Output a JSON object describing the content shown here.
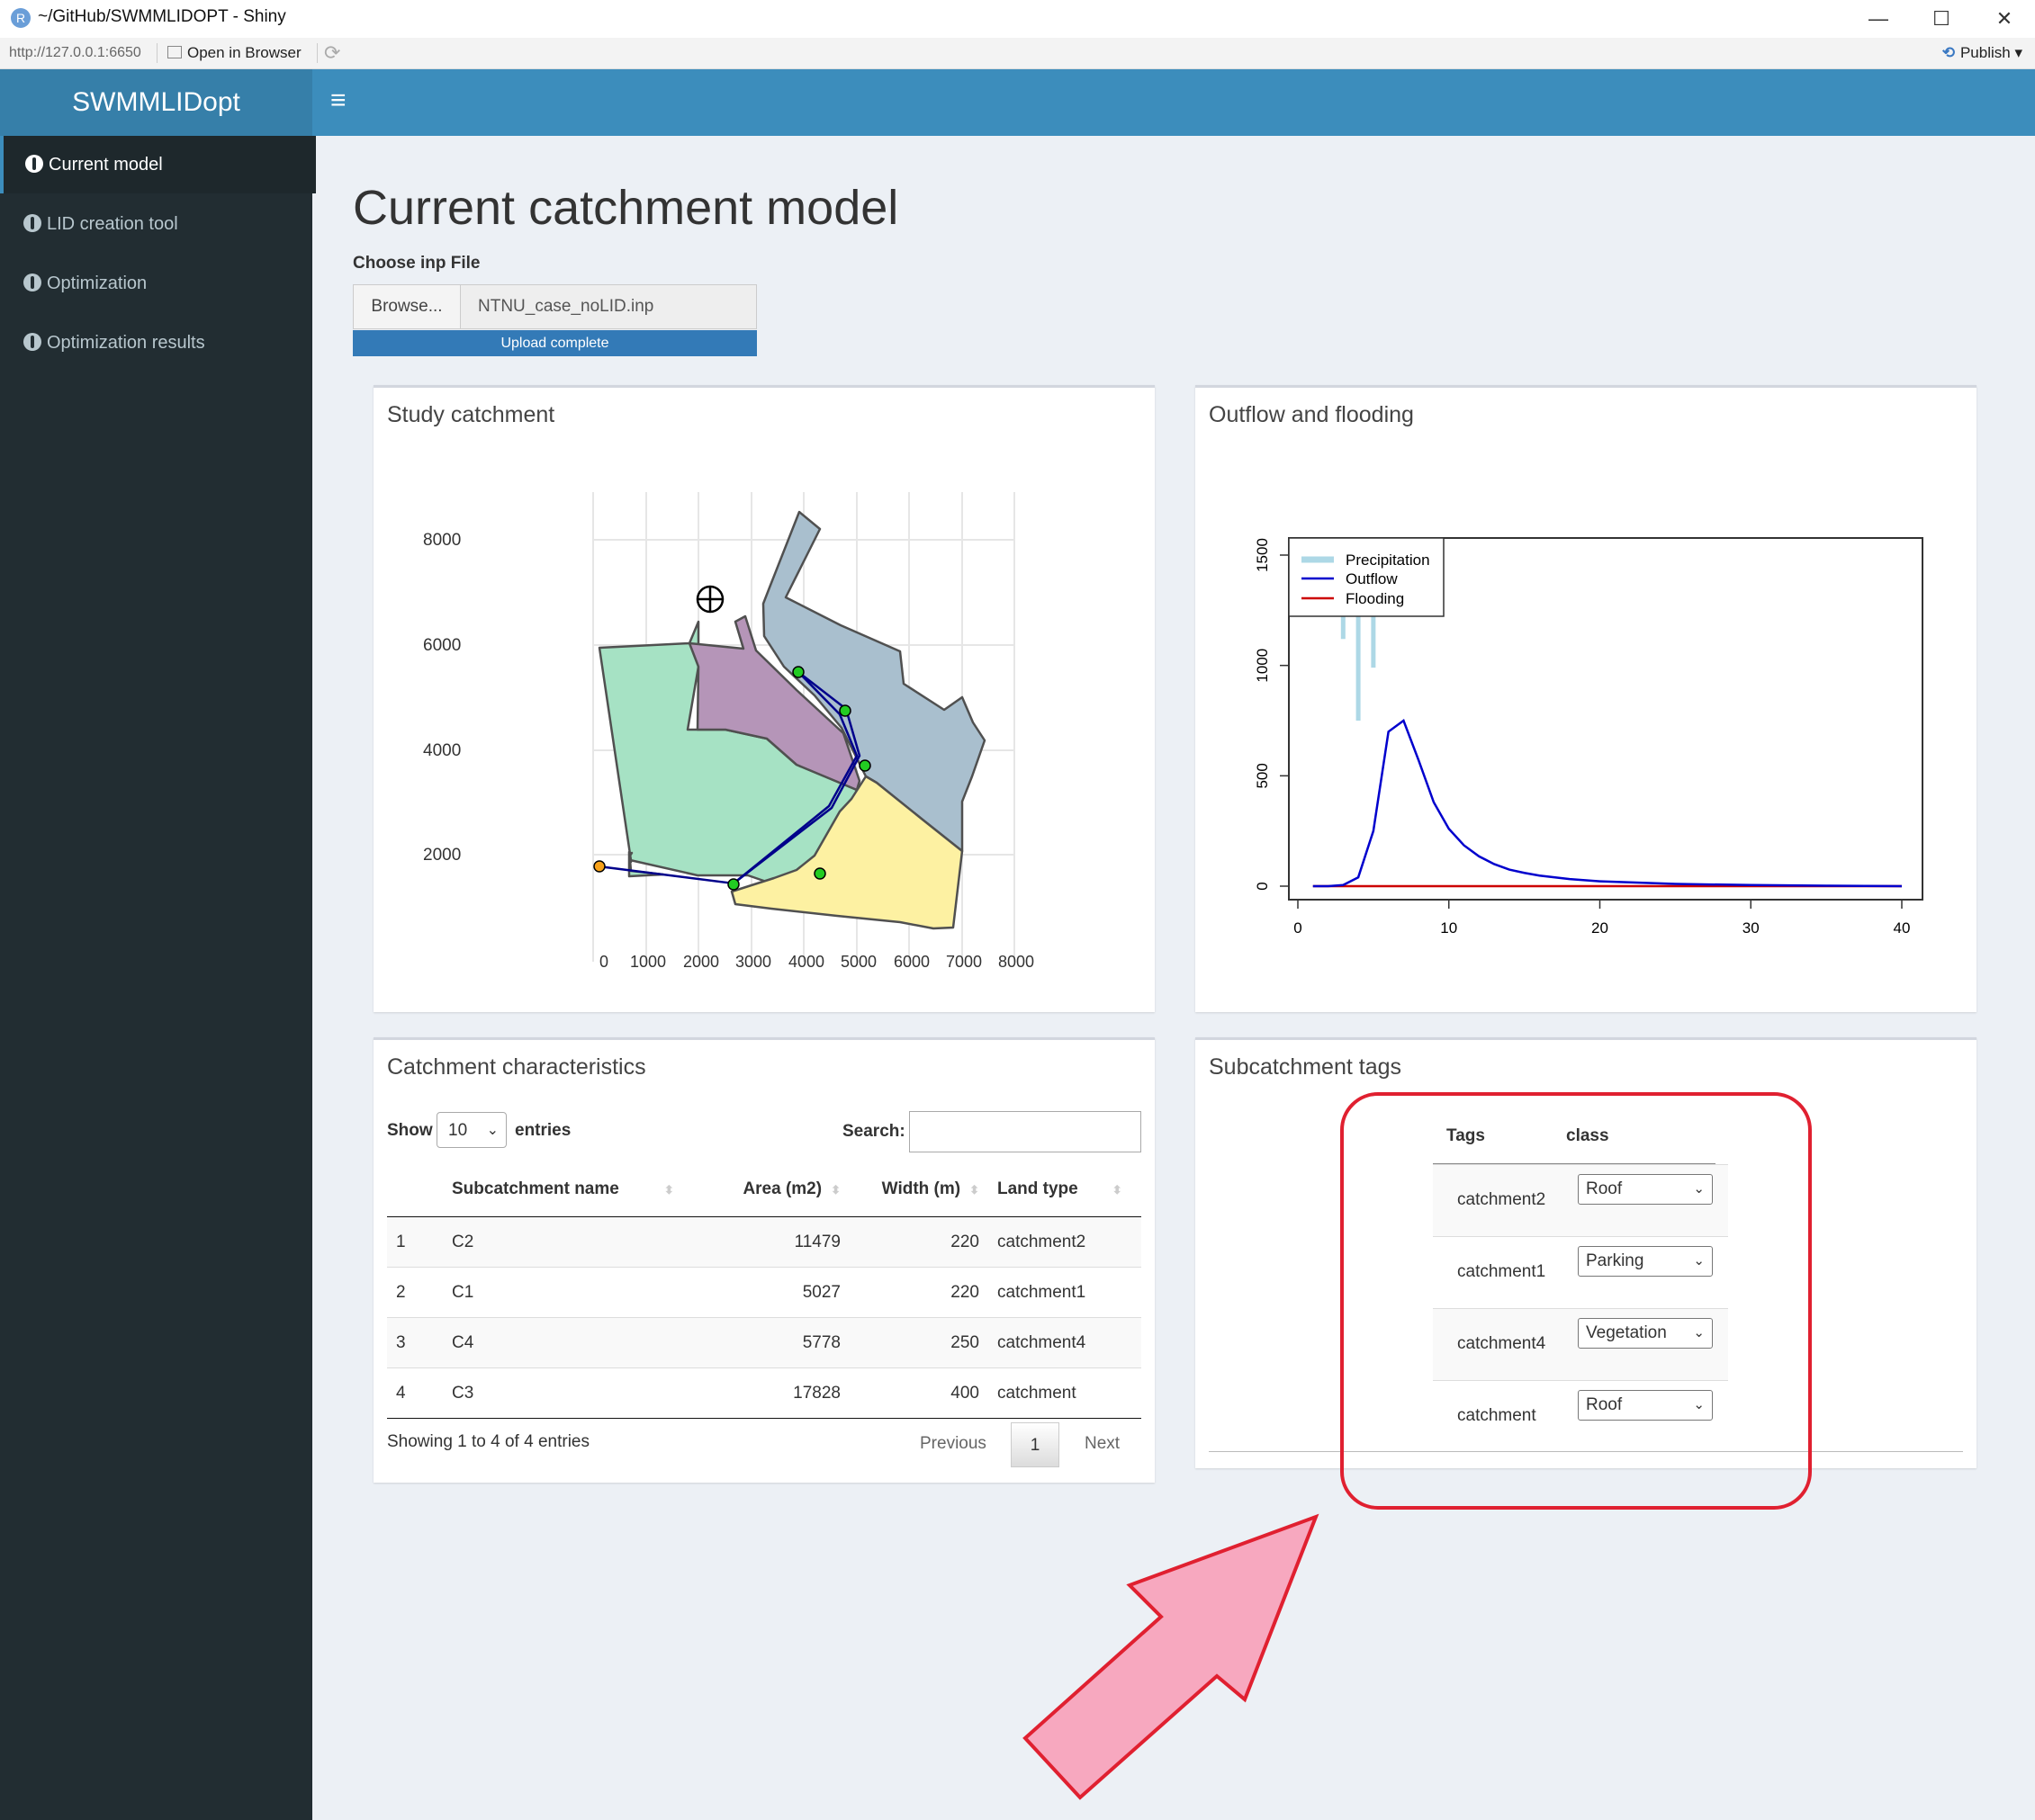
{
  "window": {
    "title": "~/GitHub/SWMMLIDOPT - Shiny",
    "minimize": "—",
    "maximize": "☐",
    "close": "✕"
  },
  "addressbar": {
    "url": "http://127.0.0.1:6650",
    "open_in_browser": "Open in Browser",
    "publish": "Publish"
  },
  "app": {
    "logo": "SWMMLIDopt",
    "toggle": "≡"
  },
  "sidebar": {
    "items": [
      {
        "label": "Current model",
        "active": true
      },
      {
        "label": "LID creation tool"
      },
      {
        "label": "Optimization"
      },
      {
        "label": "Optimization results"
      }
    ]
  },
  "page": {
    "title": "Current catchment model",
    "file_label": "Choose inp File",
    "browse": "Browse...",
    "file_name": "NTNU_case_noLID.inp",
    "upload_status": "Upload complete"
  },
  "study_catchment": {
    "title": "Study catchment",
    "y_ticks": [
      "8000",
      "6000",
      "4000",
      "2000"
    ],
    "x_ticks": [
      "0",
      "1000",
      "2000",
      "3000",
      "4000",
      "5000",
      "6000",
      "7000",
      "8000"
    ],
    "colors": {
      "green": "#a6e2c4",
      "purple": "#b595b8",
      "blue": "#a9bfce",
      "yellow": "#fdf1a2"
    }
  },
  "outflow": {
    "title": "Outflow and flooding",
    "legend": [
      "Precipitation",
      "Outflow",
      "Flooding"
    ],
    "colors": {
      "precipitation": "#add8e6",
      "outflow": "#0000cd",
      "flooding": "#cc0000"
    }
  },
  "chart_data": {
    "type": "line",
    "title": "Outflow and flooding",
    "xlim": [
      0,
      40
    ],
    "ylim": [
      0,
      1500
    ],
    "x_ticks": [
      0,
      10,
      20,
      30,
      40
    ],
    "y_ticks": [
      0,
      500,
      1000,
      1500
    ],
    "series": [
      {
        "name": "Outflow",
        "x": [
          1,
          2,
          3,
          4,
          5,
          6,
          7,
          8,
          9,
          10,
          11,
          12,
          13,
          14,
          15,
          16,
          18,
          20,
          25,
          30,
          35,
          40
        ],
        "values": [
          0,
          0,
          5,
          40,
          250,
          700,
          750,
          570,
          380,
          260,
          185,
          135,
          100,
          75,
          60,
          48,
          32,
          22,
          10,
          5,
          2,
          0
        ]
      },
      {
        "name": "Flooding",
        "x": [
          1,
          40
        ],
        "values": [
          0,
          0
        ]
      },
      {
        "name": "Precipitation",
        "x": [
          3,
          4,
          5
        ],
        "values": [
          1120,
          750,
          990
        ]
      }
    ],
    "legend_position": "top-left"
  },
  "catchment_table": {
    "title": "Catchment characteristics",
    "show": "Show",
    "page_length": "10",
    "entries": "entries",
    "search_label": "Search:",
    "columns": [
      "",
      "Subcatchment name",
      "Area (m2)",
      "Width (m)",
      "Land type"
    ],
    "rows": [
      [
        "1",
        "C2",
        "11479",
        "220",
        "catchment2"
      ],
      [
        "2",
        "C1",
        "5027",
        "220",
        "catchment1"
      ],
      [
        "3",
        "C4",
        "5778",
        "250",
        "catchment4"
      ],
      [
        "4",
        "C3",
        "17828",
        "400",
        "catchment"
      ]
    ],
    "info": "Showing 1 to 4 of 4 entries",
    "previous": "Previous",
    "current_page": "1",
    "next": "Next"
  },
  "tags": {
    "title": "Subcatchment tags",
    "headers": [
      "Tags",
      "class"
    ],
    "rows": [
      {
        "tag": "catchment2",
        "class": "Roof"
      },
      {
        "tag": "catchment1",
        "class": "Parking"
      },
      {
        "tag": "catchment4",
        "class": "Vegetation"
      },
      {
        "tag": "catchment",
        "class": "Roof"
      }
    ]
  },
  "annotation": {
    "highlight_color": "#e02030",
    "arrow_color": "#f7a8bf"
  }
}
